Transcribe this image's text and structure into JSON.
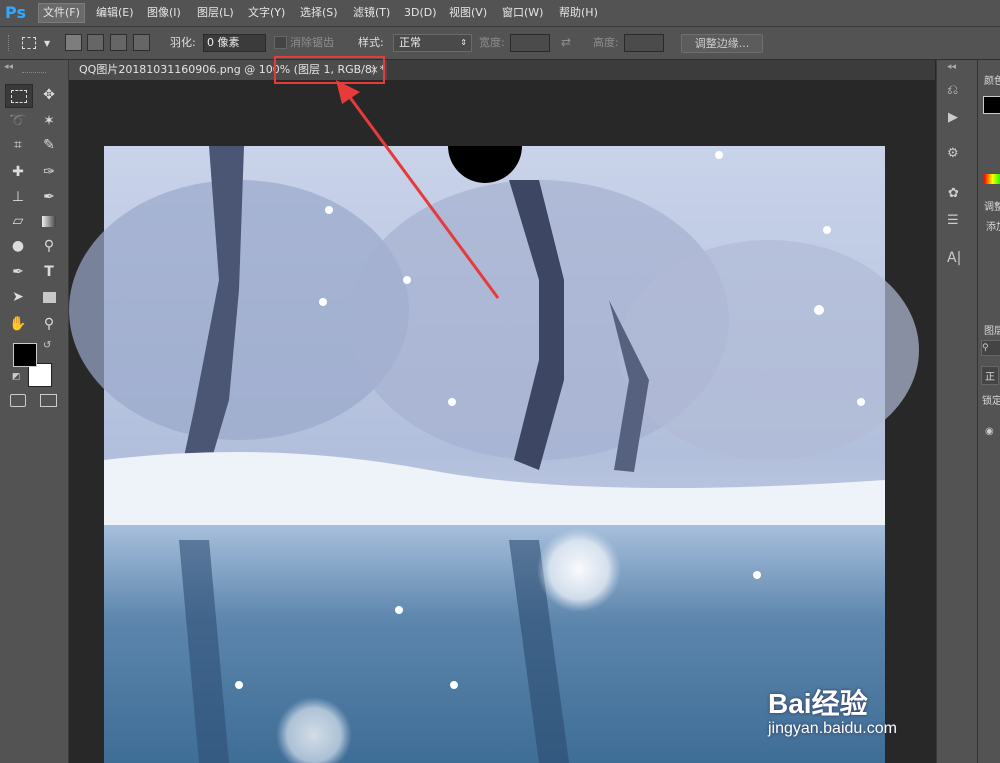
{
  "app": {
    "logo": "Ps"
  },
  "menu": [
    {
      "label": "文件(F)",
      "active": true
    },
    {
      "label": "编辑(E)"
    },
    {
      "label": "图像(I)"
    },
    {
      "label": "图层(L)"
    },
    {
      "label": "文字(Y)"
    },
    {
      "label": "选择(S)"
    },
    {
      "label": "滤镜(T)"
    },
    {
      "label": "3D(D)"
    },
    {
      "label": "视图(V)"
    },
    {
      "label": "窗口(W)"
    },
    {
      "label": "帮助(H)"
    }
  ],
  "options": {
    "feather_label": "羽化:",
    "feather_value": "0 像素",
    "antialias_label": "消除锯齿",
    "style_label": "样式:",
    "style_value": "正常",
    "width_label": "宽度:",
    "height_label": "高度:",
    "refine_button": "调整边缘..."
  },
  "document": {
    "tab_title": "QQ图片20181031160906.png @ 100% (图层 1, RGB/8) *",
    "close": "×"
  },
  "right_panel": {
    "color_label": "颜色",
    "adjust_label": "调整",
    "add_label": "添加",
    "layers_label": "图层",
    "normal_label": "正",
    "lock_label": "锁定"
  },
  "watermark": {
    "brand": "Bai经验",
    "url": "jingyan.baidu.com"
  },
  "colors": {
    "accent": "#31a8ff",
    "highlight": "#e53b3b"
  },
  "icons": [
    "marquee-icon",
    "move-icon",
    "lasso-icon",
    "magic-wand-icon",
    "crop-icon",
    "eyedropper-icon",
    "healing-icon",
    "brush-icon",
    "stamp-icon",
    "history-brush-icon",
    "eraser-icon",
    "gradient-icon",
    "blur-icon",
    "dodge-icon",
    "pen-icon",
    "type-icon",
    "path-select-icon",
    "shape-icon",
    "hand-icon",
    "zoom-icon"
  ]
}
